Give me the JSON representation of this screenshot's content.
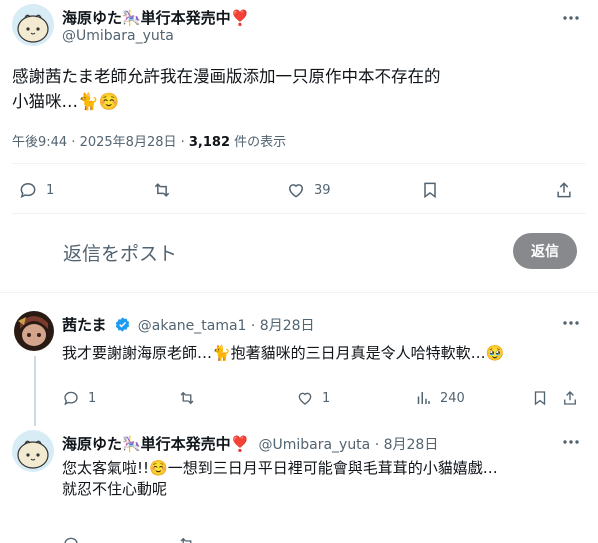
{
  "main_post": {
    "author_name": "海原ゆた🎠単行本発売中❣️",
    "handle": "@Umibara_yuta",
    "text_line1": "感謝茜たま老師允許我在漫画版添加一只原作中本不存在的",
    "text_line2": "小猫咪…🐈☺️",
    "meta_time": "午後9:44 · 2025年8月28日 · ",
    "meta_views": "3,182",
    "meta_views_label": " 件の表示",
    "replies": "1",
    "likes": "39"
  },
  "composer": {
    "placeholder": "返信をポスト",
    "reply_button": "返信"
  },
  "reply1": {
    "author_name": "茜たま",
    "handle": "@akane_tama1 · 8月28日",
    "text": "我才要謝謝海原老師…🐈抱著貓咪的三日月真是令人哈特軟軟…🥹",
    "replies": "1",
    "likes": "1",
    "views": "240"
  },
  "reply2": {
    "author_name": "海原ゆた🎠単行本発売中❣️",
    "handle": "@Umibara_yuta · 8月28日",
    "text_line1": "您太客氣啦!!☺️一想到三日月平日裡可能會與毛茸茸的小貓嬉戲…",
    "text_line2": "就忍不住心動呢"
  },
  "colors": {
    "accent": "#1d9bf0",
    "muted": "#536471",
    "reply_button": "#87898c"
  }
}
